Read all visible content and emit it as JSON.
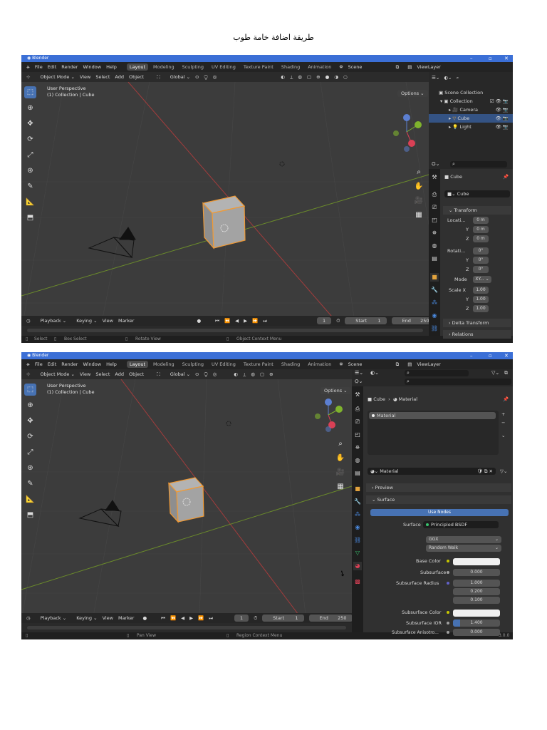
{
  "page_heading": "طريقة اضافة خامة طوب",
  "app": {
    "title": "Blender",
    "version": "3.0.0"
  },
  "menus": [
    "File",
    "Edit",
    "Render",
    "Window",
    "Help"
  ],
  "workspaces": [
    "Layout",
    "Modeling",
    "Sculpting",
    "UV Editing",
    "Texture Paint",
    "Shading",
    "Animation"
  ],
  "scene": "Scene",
  "view_layer": "ViewLayer",
  "viewport_header": {
    "mode": "Object Mode",
    "view": "View",
    "select": "Select",
    "add": "Add",
    "object": "Object",
    "orientation": "Global",
    "options": "Options"
  },
  "viewport": {
    "line1": "User Perspective",
    "line2": "(1) Collection | Cube"
  },
  "timeline": {
    "playback": "Playback",
    "keying": "Keying",
    "view": "View",
    "marker": "Marker",
    "frame": "1",
    "start_label": "Start",
    "start": "1",
    "end_label": "End",
    "end": "250"
  },
  "status1": {
    "select": "Select",
    "box_select": "Box Select",
    "rotate_view": "Rotate View",
    "context_menu": "Object Context Menu"
  },
  "status2": {
    "pan_view": "Pan View",
    "context_menu": "Region Context Menu"
  },
  "outliner": {
    "scene_collection": "Scene Collection",
    "collection": "Collection",
    "camera": "Camera",
    "cube": "Cube",
    "light": "Light"
  },
  "object_props": {
    "object": "Cube",
    "name": "Cube",
    "transform": "Transform",
    "location_label": "Locati...",
    "loc": [
      "0 m",
      "0 m",
      "0 m"
    ],
    "rotation_label": "Rotati...",
    "rot": [
      "0°",
      "0°",
      "0°"
    ],
    "mode_label": "Mode",
    "mode": "XY...",
    "scale_label": "Scale X",
    "scale": [
      "1.00",
      "1.00",
      "1.00"
    ],
    "delta_transform": "Delta Transform",
    "relations": "Relations",
    "y": "Y",
    "z": "Z"
  },
  "material_props": {
    "breadcrumb_object": "Cube",
    "breadcrumb_material": "Material",
    "slot": "Material",
    "datablock": "Material",
    "preview": "Preview",
    "surface_panel": "Surface",
    "use_nodes": "Use Nodes",
    "surface_label": "Surface",
    "surface_value": "Principled BSDF",
    "distribution": "GGX",
    "subsurface_method": "Random Walk",
    "base_color_label": "Base Color",
    "subsurface_label": "Subsurface",
    "subsurface_value": "0.000",
    "subsurface_radius_label": "Subsurface Radius",
    "radius": [
      "1.000",
      "0.200",
      "0.100"
    ],
    "subsurface_color_label": "Subsurface Color",
    "subsurface_ior_label": "Subsurface IOR",
    "subsurface_ior_value": "1.400",
    "subsurface_aniso_label": "Subsurface Anisotro...",
    "subsurface_aniso_value": "0.000"
  },
  "colors": {
    "accent": "#4772b3",
    "selection": "#345384",
    "object_outline": "#f09a35",
    "bg": "#303030",
    "header": "#232323",
    "title_bar": "#3b6fd6"
  }
}
